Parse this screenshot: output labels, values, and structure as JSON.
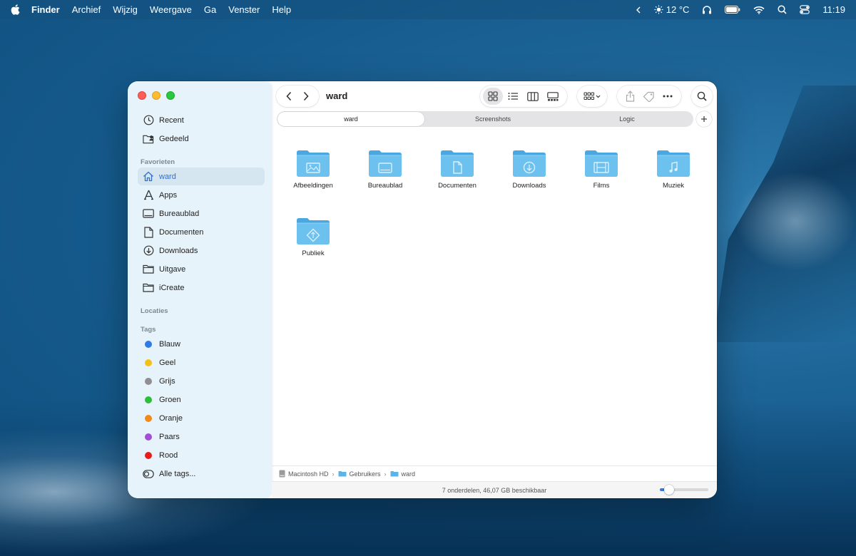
{
  "menubar": {
    "app": "Finder",
    "items": [
      "Archief",
      "Wijzig",
      "Weergave",
      "Ga",
      "Venster",
      "Help"
    ],
    "weather": "12 °C",
    "clock": "11:19"
  },
  "window": {
    "title": "ward",
    "tabs": [
      "ward",
      "Screenshots",
      "Logic"
    ]
  },
  "sidebar": {
    "top_items": [
      {
        "label": "Recent",
        "icon": "clock-icon"
      },
      {
        "label": "Gedeeld",
        "icon": "shared-folder-icon"
      }
    ],
    "favorites_title": "Favorieten",
    "favorites": [
      {
        "label": "ward",
        "icon": "home-icon"
      },
      {
        "label": "Apps",
        "icon": "apps-icon"
      },
      {
        "label": "Bureaublad",
        "icon": "desktop-icon"
      },
      {
        "label": "Documenten",
        "icon": "document-icon"
      },
      {
        "label": "Downloads",
        "icon": "download-icon"
      },
      {
        "label": "Uitgave",
        "icon": "folder-icon"
      },
      {
        "label": "iCreate",
        "icon": "folder-icon"
      }
    ],
    "locations_title": "Locaties",
    "tags_title": "Tags",
    "tags": [
      {
        "label": "Blauw",
        "color": "#2f7ae5"
      },
      {
        "label": "Geel",
        "color": "#f2c019"
      },
      {
        "label": "Grijs",
        "color": "#8e8e93"
      },
      {
        "label": "Groen",
        "color": "#2bbf3a"
      },
      {
        "label": "Oranje",
        "color": "#f28a1a"
      },
      {
        "label": "Paars",
        "color": "#a04fd6"
      },
      {
        "label": "Rood",
        "color": "#e81c1c"
      }
    ],
    "all_tags": "Alle tags..."
  },
  "folders": [
    {
      "label": "Afbeeldingen",
      "glyph": "image-icon"
    },
    {
      "label": "Bureaublad",
      "glyph": "desktop-icon"
    },
    {
      "label": "Documenten",
      "glyph": "document-icon"
    },
    {
      "label": "Downloads",
      "glyph": "download-icon"
    },
    {
      "label": "Films",
      "glyph": "film-icon"
    },
    {
      "label": "Muziek",
      "glyph": "music-icon"
    },
    {
      "label": "Publiek",
      "glyph": "public-icon"
    }
  ],
  "path": [
    "Macintosh HD",
    "Gebruikers",
    "ward"
  ],
  "status": "7 onderdelen, 46,07 GB beschikbaar",
  "icon_size_level": 0.15
}
